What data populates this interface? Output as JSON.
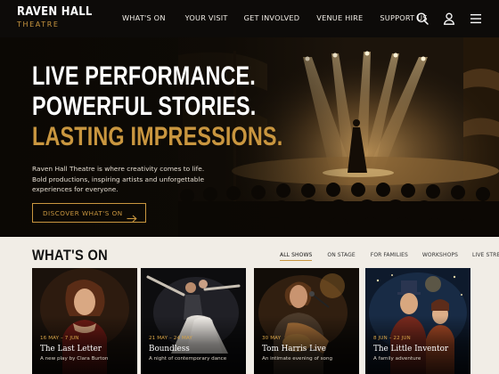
{
  "header": {
    "logo_top": "RAVEN HALL",
    "logo_bottom": "THEATRE",
    "nav": [
      "WHAT'S ON",
      "YOUR VISIT",
      "GET INVOLVED",
      "VENUE HIRE",
      "SUPPORT US"
    ],
    "icons": [
      "search-icon",
      "account-icon",
      "menu-icon"
    ]
  },
  "hero": {
    "headline_1": "LIVE PERFORMANCE.",
    "headline_2": "POWERFUL STORIES.",
    "headline_3": "LASTING IMPRESSIONS.",
    "description": "Raven Hall Theatre is where creativity comes to life. Bold productions, inspiring artists and unforgettable experiences for everyone.",
    "cta_label": "DISCOVER WHAT'S ON",
    "cta_icon": "arrow-right-icon"
  },
  "whats_on": {
    "title": "WHAT'S ON",
    "filters": [
      "ALL SHOWS",
      "ON STAGE",
      "FOR FAMILIES",
      "WORKSHOPS",
      "LIVE STREAM"
    ],
    "active_filter": "ALL SHOWS",
    "cards": [
      {
        "date": "16 MAY – 7 JUN",
        "title": "The Last Letter",
        "subtitle": "A new play by Clara Burton"
      },
      {
        "date": "21 MAY – 24 MAY",
        "title": "Boundless",
        "subtitle": "A night of contemporary dance"
      },
      {
        "date": "30 MAY",
        "title": "Tom Harris Live",
        "subtitle": "An intimate evening of song"
      },
      {
        "date": "8 JUN – 22 JUN",
        "title": "The Little Inventor",
        "subtitle": "A family adventure"
      }
    ]
  },
  "colors": {
    "accent_gold": "#c9963f",
    "header_bg": "#0d0b09",
    "page_bg": "#f1ede6"
  }
}
